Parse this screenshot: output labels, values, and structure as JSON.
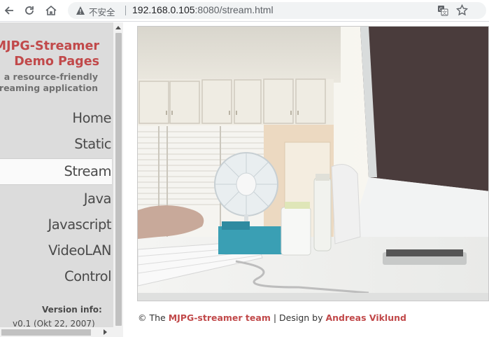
{
  "browser": {
    "security_label": "不安全",
    "url_host": "192.168.0.105",
    "url_rest": ":8080/stream.html"
  },
  "sidebar": {
    "title_line1": "MJPG-Streamer",
    "title_line2": "Demo Pages",
    "subtitle_line1": "a resource-friendly",
    "subtitle_line2": "streaming application",
    "nav": [
      "Home",
      "Static",
      "Stream",
      "Java",
      "Javascript",
      "VideoLAN",
      "Control"
    ],
    "active_item": "Stream",
    "version_label": "Version info:",
    "version_value": "v0.1 (Okt 22, 2007)"
  },
  "footer": {
    "copyright": "© The",
    "team_link": "MJPG-streamer team",
    "design_text": "| Design by",
    "author_link": "Andreas Viklund"
  },
  "colors": {
    "accent": "#c1494a",
    "sidebar_bg": "#dcdcdc",
    "nav_text": "#4a4a4a"
  }
}
